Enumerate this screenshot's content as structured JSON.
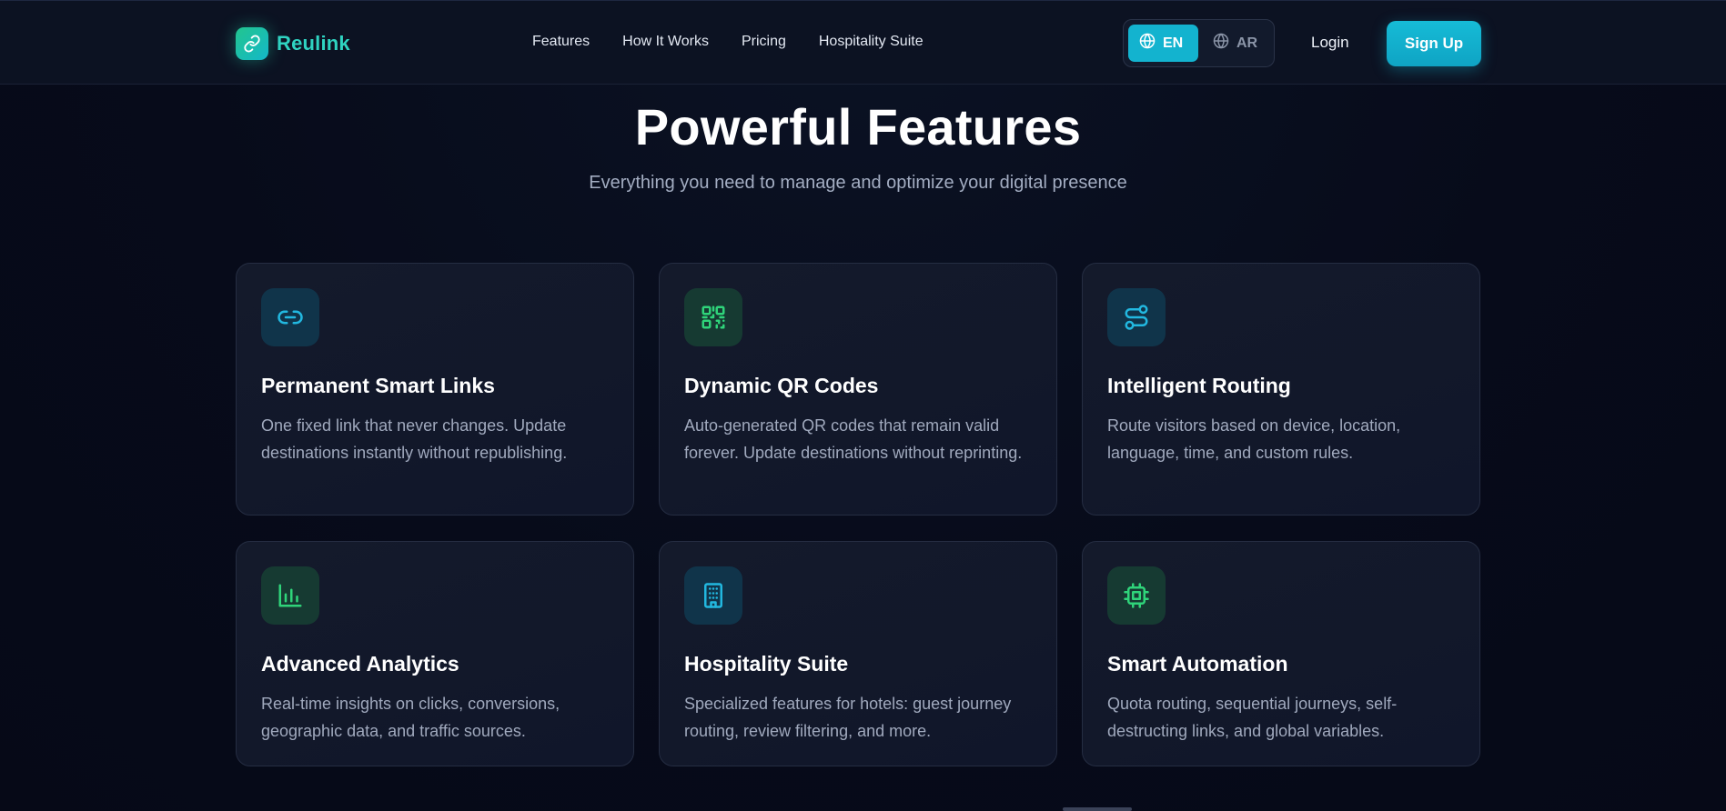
{
  "brand": {
    "name": "Reulink",
    "logo_icon": "link-icon"
  },
  "nav": {
    "links": [
      "Features",
      "How It Works",
      "Pricing",
      "Hospitality Suite"
    ]
  },
  "language": {
    "options": [
      {
        "code": "EN",
        "icon": "globe-icon",
        "active": true
      },
      {
        "code": "AR",
        "icon": "globe-icon",
        "active": false
      }
    ]
  },
  "auth": {
    "login_label": "Login",
    "signup_label": "Sign Up"
  },
  "section": {
    "title": "Powerful Features",
    "subtitle": "Everything you need to manage and optimize your digital presence"
  },
  "features": [
    {
      "title": "Permanent Smart Links",
      "description": "One fixed link that never changes. Update destinations instantly without republishing.",
      "icon": "link-icon",
      "accent": "#22b8e0"
    },
    {
      "title": "Dynamic QR Codes",
      "description": "Auto-generated QR codes that remain valid forever. Update destinations without reprinting.",
      "icon": "qr-code-icon",
      "accent": "#2fd47a"
    },
    {
      "title": "Intelligent Routing",
      "description": "Route visitors based on device, location, language, time, and custom rules.",
      "icon": "route-icon",
      "accent": "#22b8e0"
    },
    {
      "title": "Advanced Analytics",
      "description": "Real-time insights on clicks, conversions, geographic data, and traffic sources.",
      "icon": "bar-chart-icon",
      "accent": "#2fd47a"
    },
    {
      "title": "Hospitality Suite",
      "description": "Specialized features for hotels: guest journey routing, review filtering, and more.",
      "icon": "building-icon",
      "accent": "#22b8e0"
    },
    {
      "title": "Smart Automation",
      "description": "Quota routing, sequential journeys, self-destructing links, and global variables.",
      "icon": "cpu-icon",
      "accent": "#2fd47a"
    }
  ],
  "colors": {
    "background": "#070b1a",
    "navbar": "#0c1222",
    "primary": "#13b3cf",
    "brand_text": "#2fd3c1"
  }
}
